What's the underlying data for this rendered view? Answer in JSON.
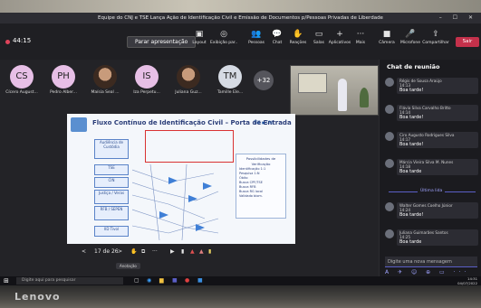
{
  "window": {
    "title": "Equipe do CNJ e TSE Lança Ação de Identificação Civil e Emissão de Documentos p/Pessoas Privadas de Liberdade",
    "controls": "– ☐ ✕"
  },
  "toolbar": {
    "timer": "44:15",
    "present_label": "Parar apresentação",
    "tools": [
      {
        "icon": "▣",
        "label": "Layout"
      },
      {
        "icon": "◎",
        "label": "Exibição par..."
      },
      {
        "icon": "👥",
        "label": "Pessoas"
      },
      {
        "icon": "💬",
        "label": "Chat"
      },
      {
        "icon": "✋",
        "label": "Reações"
      },
      {
        "icon": "▭",
        "label": "Salas"
      },
      {
        "icon": "+",
        "label": "Aplicativos"
      },
      {
        "icon": "···",
        "label": "Mais"
      },
      {
        "icon": "■",
        "label": "Câmera"
      },
      {
        "icon": "🎤",
        "label": "Microfone"
      },
      {
        "icon": "⇪",
        "label": "Compartilhar"
      }
    ],
    "leave_label": "Sair"
  },
  "participants": [
    {
      "initials": "CS",
      "name": "Cícero August...",
      "color": "#e7bfe6"
    },
    {
      "initials": "PH",
      "name": "Pedro Alber...",
      "color": "#e7bfe6"
    },
    {
      "initials": "",
      "name": "Maísia Seal ...",
      "color": "#c89b7b"
    },
    {
      "initials": "IS",
      "name": "Iza Perpetu...",
      "color": "#e7bfe6"
    },
    {
      "initials": "",
      "name": "Juliana Guz...",
      "color": "#c89b7b"
    },
    {
      "initials": "TM",
      "name": "Tamille Ele...",
      "color": "#d6dbe4"
    }
  ],
  "more_participants": "+32",
  "slide": {
    "title": "Fluxo Contínuo de Identificação Civil – Porta de Entrada",
    "brand": "TSE ▣ CNJ",
    "boxes": [
      "Audiência de Custódia",
      "TSE",
      "CIN",
      "Justiça / Veras",
      "RFB / SEPEN",
      "IID Tivol"
    ],
    "verif_title": "Possibilidades de Verificação",
    "verif_items": [
      "Identificação 1:1",
      "Pesquisa 1:N",
      "Óbito",
      "Busca CPF/TSE",
      "Busca RFB",
      "Busca RG local",
      "Validado biom."
    ]
  },
  "presenter": {
    "page": "17 de 26",
    "prev": "<",
    "next": ">",
    "tooltip": "Anotação"
  },
  "chat": {
    "header": "Chat de reunião",
    "messages": [
      {
        "name": "Régis de Sousa Araújo",
        "time": "14:13",
        "text": "Boa tarde!"
      },
      {
        "name": "Flávia Silva Carvalho Britto",
        "time": "14:14",
        "text": "Boa tarde!"
      },
      {
        "name": "Ciro Augusto Rodrigues Silva",
        "time": "14:17",
        "text": "Boa tarde!"
      },
      {
        "name": "Márcia Vieira Silva M. Nunes",
        "time": "14:18",
        "text": "Boa tarde"
      },
      {
        "name": "Walter Gomes Coelho Júnior",
        "time": "14:24",
        "text": "Boa tarde!"
      },
      {
        "name": "Juliana Guimarães Santos",
        "time": "14:25",
        "text": "Boa tarde"
      }
    ],
    "unread_label": "Última lida",
    "input_placeholder": "Digite uma nova mensagem",
    "bar_icons": "A ✈ ☺ ⊕ ▭ ···"
  },
  "taskbar": {
    "search_placeholder": "Digite aqui para pesquisar",
    "time": "14:31",
    "date": "04/07/2022"
  },
  "bezel_brand": "Lenovo"
}
